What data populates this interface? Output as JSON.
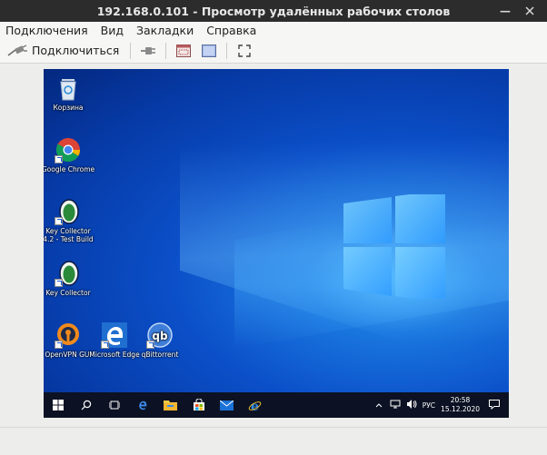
{
  "window": {
    "title": "192.168.0.101 - Просмотр удалённых рабочих столов"
  },
  "menu": [
    "Подключения",
    "Вид",
    "Закладки",
    "Справка"
  ],
  "toolbar": {
    "connect_label": "Подключиться"
  },
  "desktop": {
    "icons": [
      {
        "label": "Корзина"
      },
      {
        "label": "Google Chrome"
      },
      {
        "label": "Key Collector 4.2 - Test Build"
      },
      {
        "label": "Key Collector"
      },
      {
        "label": "OpenVPN GUI"
      },
      {
        "label": "Microsoft Edge"
      },
      {
        "label": "qBittorrent"
      }
    ]
  },
  "taskbar": {
    "language": "РУС",
    "time": "20:58",
    "date": "15.12.2020"
  },
  "colors": {
    "titlebar": "#2c2c2c",
    "desktop_blue": "#0b4fc8",
    "taskbar": "#0c1223"
  }
}
